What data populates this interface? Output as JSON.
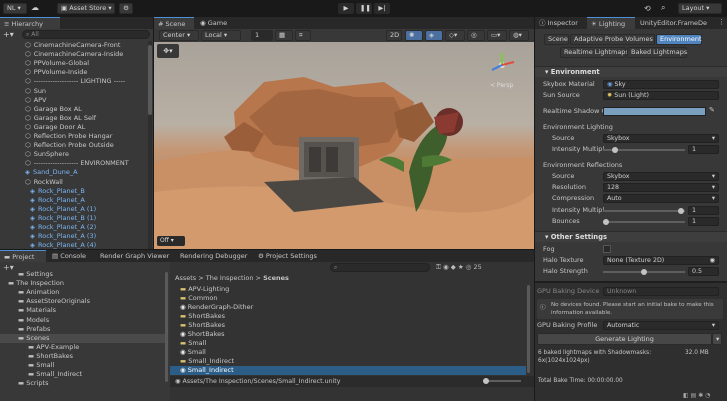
{
  "toolbar": {
    "account": "NL",
    "asset_store": "Asset Store",
    "layout": "Layout"
  },
  "hierarchy": {
    "tab": "Hierarchy",
    "search_placeholder": "All",
    "items": [
      {
        "label": "CinemachineCamera-Front",
        "blue": false,
        "indent": 0
      },
      {
        "label": "CinemachineCamera-Inside",
        "blue": false,
        "indent": 0
      },
      {
        "label": "PPVolume-Global",
        "blue": false,
        "indent": 0
      },
      {
        "label": "PPVolume-Inside",
        "blue": false,
        "indent": 0
      },
      {
        "label": "------------------- LIGHTING -----",
        "blue": false,
        "indent": 0
      },
      {
        "label": "Sun",
        "blue": false,
        "indent": 0
      },
      {
        "label": "APV",
        "blue": false,
        "indent": 0
      },
      {
        "label": "Garage Box AL",
        "blue": false,
        "indent": 0
      },
      {
        "label": "Garage Box AL Self",
        "blue": false,
        "indent": 0
      },
      {
        "label": "Garage Door AL",
        "blue": false,
        "indent": 0
      },
      {
        "label": "Reflection Probe Hangar",
        "blue": false,
        "indent": 0
      },
      {
        "label": "Reflection Probe Outside",
        "blue": false,
        "indent": 0
      },
      {
        "label": "SunSphere",
        "blue": false,
        "indent": 0
      },
      {
        "label": "------------------- ENVIRONMENT",
        "blue": false,
        "indent": 0
      },
      {
        "label": "Sand_Dune_A",
        "blue": true,
        "indent": 0
      },
      {
        "label": "RockWall",
        "blue": false,
        "indent": 0
      },
      {
        "label": "Rock_Planet_B",
        "blue": true,
        "indent": 1
      },
      {
        "label": "Rock_Planet_A",
        "blue": true,
        "indent": 1
      },
      {
        "label": "Rock_Planet_A (1)",
        "blue": true,
        "indent": 1
      },
      {
        "label": "Rock_Planet_B (1)",
        "blue": true,
        "indent": 1
      },
      {
        "label": "Rock_Planet_A (2)",
        "blue": true,
        "indent": 1
      },
      {
        "label": "Rock_Planet_A (3)",
        "blue": true,
        "indent": 1
      },
      {
        "label": "Rock_Planet_A (4)",
        "blue": true,
        "indent": 1
      }
    ]
  },
  "scene": {
    "tab_scene": "Scene",
    "tab_game": "Game",
    "pivot": "Center",
    "space": "Local",
    "grid_value": "1",
    "mode_2d": "2D",
    "persp": "< Persp",
    "overlay": "Off"
  },
  "inspector": {
    "tabs": [
      "Inspector",
      "Lighting",
      "UnityEditor.FrameDe"
    ],
    "subtabs": [
      "Scene",
      "Adaptive Probe Volumes",
      "Environment"
    ],
    "subtabs2": [
      "Realtime Lightmaps",
      "Baked Lightmaps"
    ],
    "environment": {
      "header": "Environment",
      "skybox_label": "Skybox Material",
      "skybox_value": "Sky",
      "sun_label": "Sun Source",
      "sun_value": "Sun (Light)",
      "shadow_label": "Realtime Shadow C",
      "env_light_header": "Environment Lighting",
      "source_label": "Source",
      "source_value": "Skybox",
      "intensity_label": "Intensity Multipl",
      "intensity_value": "1",
      "refl_header": "Environment Reflections",
      "rsource_label": "Source",
      "rsource_value": "Skybox",
      "res_label": "Resolution",
      "res_value": "128",
      "comp_label": "Compression",
      "comp_value": "Auto",
      "rint_label": "Intensity Multipl",
      "rint_value": "1",
      "bounces_label": "Bounces",
      "bounces_value": "1"
    },
    "other": {
      "header": "Other Settings",
      "fog_label": "Fog",
      "halo_label": "Halo Texture",
      "halo_value": "None (Texture 2D)",
      "halo_str_label": "Halo Strength",
      "halo_str_value": "0.5"
    },
    "bake": {
      "device_label": "GPU Baking Device",
      "device_value": "Unknown",
      "warning": "No devices found. Please start an initial bake to make this information available.",
      "profile_label": "GPU Baking Profile",
      "profile_value": "Automatic",
      "generate": "Generate Lighting",
      "stats": "6 baked lightmaps with Shadowmasks:",
      "stats2": "6x(1024x1024px)",
      "size": "32.0 MB",
      "total": "Total Bake Time: 00:00:00.00"
    }
  },
  "bottom": {
    "tabs": [
      "Project",
      "Console",
      "Render Graph Viewer",
      "Rendering Debugger",
      "Project Settings"
    ],
    "breadcrumb": [
      "Assets",
      "The Inspection",
      "Scenes"
    ],
    "hidden_count": "25",
    "tree": [
      {
        "label": "Settings",
        "indent": 1,
        "cut": true
      },
      {
        "label": "The Inspection",
        "indent": 0
      },
      {
        "label": "Animation",
        "indent": 1
      },
      {
        "label": "AssetStoreOriginals",
        "indent": 1
      },
      {
        "label": "Materials",
        "indent": 1
      },
      {
        "label": "Models",
        "indent": 1
      },
      {
        "label": "Prefabs",
        "indent": 1
      },
      {
        "label": "Scenes",
        "indent": 1,
        "selected": true
      },
      {
        "label": "APV-Example",
        "indent": 2
      },
      {
        "label": "ShortBakes",
        "indent": 2
      },
      {
        "label": "Small",
        "indent": 2
      },
      {
        "label": "Small_Indirect",
        "indent": 2
      },
      {
        "label": "Scripts",
        "indent": 1
      }
    ],
    "files": [
      {
        "label": "APV-Lighting",
        "type": "folder"
      },
      {
        "label": "Common",
        "type": "folder"
      },
      {
        "label": "RenderGraph-Dither",
        "type": "scene"
      },
      {
        "label": "ShortBakes",
        "type": "folder"
      },
      {
        "label": "ShortBakes",
        "type": "folder"
      },
      {
        "label": "ShortBakes",
        "type": "scene"
      },
      {
        "label": "Small",
        "type": "folder"
      },
      {
        "label": "Small",
        "type": "scene"
      },
      {
        "label": "Small_Indirect",
        "type": "folder"
      },
      {
        "label": "Small_Indirect",
        "type": "scene",
        "selected": true
      }
    ],
    "path": "Assets/The Inspection/Scenes/Small_Indirect.unity"
  }
}
